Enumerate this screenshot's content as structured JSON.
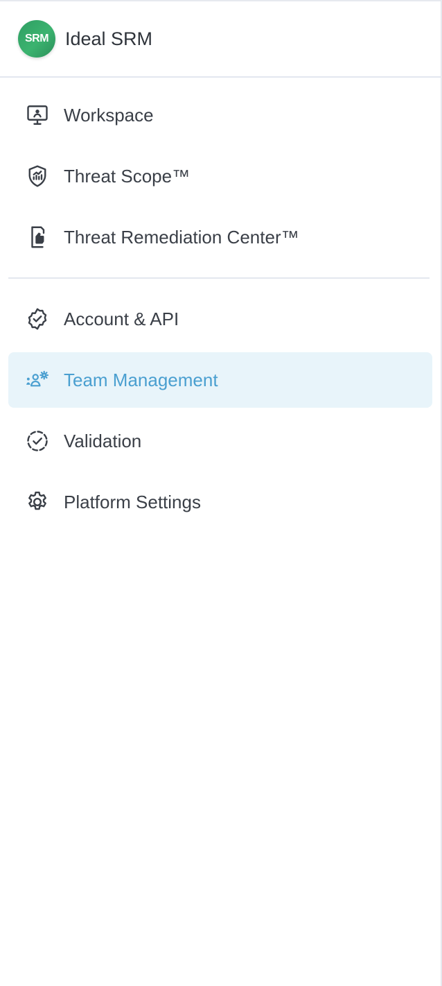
{
  "brand": {
    "logo_text": "SRM",
    "name": "Ideal SRM"
  },
  "nav_primary": [
    {
      "label": "Workspace",
      "icon": "monitor-user-icon"
    },
    {
      "label": "Threat Scope™",
      "icon": "shield-chart-icon"
    },
    {
      "label": "Threat Remediation Center™",
      "icon": "document-hand-icon"
    }
  ],
  "nav_secondary": [
    {
      "label": "Account & API",
      "icon": "badge-check-icon"
    },
    {
      "label": "Team Management",
      "icon": "team-gear-icon",
      "active": true
    },
    {
      "label": "Validation",
      "icon": "dashed-check-icon"
    },
    {
      "label": "Platform Settings",
      "icon": "gear-icon"
    }
  ],
  "colors": {
    "active_text": "#4a9fd0",
    "active_bg": "#e8f4fa",
    "logo_green": "#3bb36f",
    "text": "#3a3f47"
  }
}
